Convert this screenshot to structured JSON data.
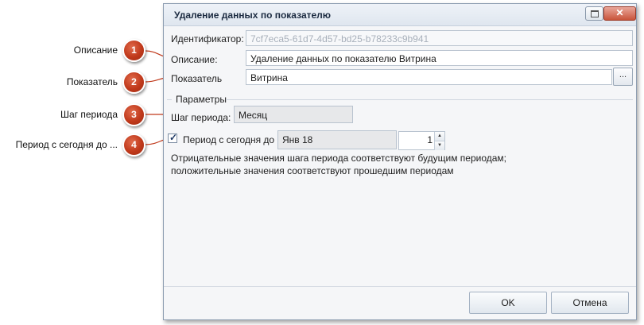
{
  "callouts": [
    {
      "number": "1",
      "label": "Описание"
    },
    {
      "number": "2",
      "label": "Показатель"
    },
    {
      "number": "3",
      "label": "Шаг периода"
    },
    {
      "number": "4",
      "label": "Период с сегодня до ..."
    }
  ],
  "dialog": {
    "title": "Удаление данных по показателю",
    "close_glyph": "✕",
    "identifier_label": "Идентификатор:",
    "identifier_value": "7cf7eca5-61d7-4d57-bd25-b78233c9b941",
    "description_label": "Описание:",
    "description_value": "Удаление данных по показателю Витрина",
    "indicator_label": "Показатель",
    "indicator_value": "Витрина",
    "browse_label": "...",
    "parameters_group": "Параметры",
    "period_step_label": "Шаг периода:",
    "period_step_value": "Месяц",
    "period_checkbox_label": "Период с сегодня до",
    "period_checked": true,
    "period_date": "Янв 18",
    "period_count": "1",
    "note_line1": "Отрицательные значения шага периода соответствуют будущим периодам;",
    "note_line2": "положительные значения соответствуют прошедшим периодам",
    "ok_label": "OK",
    "cancel_label": "Отмена"
  },
  "colors": {
    "badge": "#c0391b",
    "window_border": "#8d9db1",
    "readonly_text": "#a8b0bb"
  }
}
